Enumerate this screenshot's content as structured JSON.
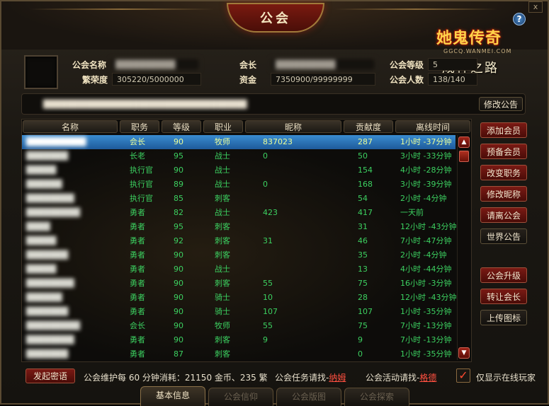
{
  "window": {
    "title": "公会",
    "help_label": "?",
    "close_label": "x"
  },
  "logo": {
    "brand": "她鬼传奇",
    "url": "GGCQ.WANMEI.COM",
    "subtitle": "成神之路"
  },
  "guild_info": {
    "name_label": "公会名称",
    "name_value": "██████████",
    "prosperity_label": "繁荣度",
    "prosperity_value": "305220/5000000",
    "leader_label": "会长",
    "leader_value": "██████████",
    "funds_label": "资金",
    "funds_value": "7350900/99999999",
    "level_label": "公会等级",
    "level_value": "5",
    "members_label": "公会人数",
    "members_value": "138/140"
  },
  "notice": {
    "text": "██████████████████████████████████",
    "edit_button": "修改公告"
  },
  "table": {
    "headers": [
      "名称",
      "职务",
      "等级",
      "职业",
      "昵称",
      "贡献度",
      "离线时间"
    ],
    "rows": [
      {
        "name": "██████████",
        "role": "会长",
        "level": "90",
        "class": "牧师",
        "nick": "837023",
        "contrib": "287",
        "offline": "1小时 -37分钟"
      },
      {
        "name": "███████",
        "role": "长老",
        "level": "95",
        "class": "战士",
        "nick": "0",
        "contrib": "50",
        "offline": "3小时 -33分钟"
      },
      {
        "name": "█████",
        "role": "执行官",
        "level": "90",
        "class": "战士",
        "nick": "",
        "contrib": "154",
        "offline": "4小时 -28分钟"
      },
      {
        "name": "██████",
        "role": "执行官",
        "level": "89",
        "class": "战士",
        "nick": "0",
        "contrib": "168",
        "offline": "3小时 -39分钟"
      },
      {
        "name": "████████",
        "role": "执行官",
        "level": "85",
        "class": "刺客",
        "nick": "",
        "contrib": "54",
        "offline": "2小时 -4分钟"
      },
      {
        "name": "█████████",
        "role": "勇者",
        "level": "82",
        "class": "战士",
        "nick": "423",
        "contrib": "417",
        "offline": "一天前"
      },
      {
        "name": "████",
        "role": "勇者",
        "level": "95",
        "class": "刺客",
        "nick": "",
        "contrib": "31",
        "offline": "12小时 -43分钟"
      },
      {
        "name": "█████",
        "role": "勇者",
        "level": "92",
        "class": "刺客",
        "nick": "31",
        "contrib": "46",
        "offline": "7小时 -47分钟"
      },
      {
        "name": "███████",
        "role": "勇者",
        "level": "90",
        "class": "刺客",
        "nick": "",
        "contrib": "35",
        "offline": "2小时 -4分钟"
      },
      {
        "name": "█████",
        "role": "勇者",
        "level": "90",
        "class": "战士",
        "nick": "",
        "contrib": "13",
        "offline": "4小时 -44分钟"
      },
      {
        "name": "████████",
        "role": "勇者",
        "level": "90",
        "class": "刺客",
        "nick": "55",
        "contrib": "75",
        "offline": "16小时 -3分钟"
      },
      {
        "name": "██████",
        "role": "勇者",
        "level": "90",
        "class": "骑士",
        "nick": "10",
        "contrib": "28",
        "offline": "12小时 -43分钟"
      },
      {
        "name": "███████",
        "role": "勇者",
        "level": "90",
        "class": "骑士",
        "nick": "107",
        "contrib": "107",
        "offline": "1小时 -35分钟"
      },
      {
        "name": "█████████",
        "role": "会长",
        "level": "90",
        "class": "牧师",
        "nick": "55",
        "contrib": "75",
        "offline": "7小时 -13分钟"
      },
      {
        "name": "████████",
        "role": "勇者",
        "level": "90",
        "class": "刺客",
        "nick": "9",
        "contrib": "9",
        "offline": "7小时 -13分钟"
      },
      {
        "name": "███████",
        "role": "勇者",
        "level": "87",
        "class": "刺客",
        "nick": "",
        "contrib": "0",
        "offline": "1小时 -35分钟"
      }
    ]
  },
  "side_buttons": [
    "添加会员",
    "预备会员",
    "改变职务",
    "修改昵称",
    "请离公会",
    "世界公告",
    "公会升级",
    "转让会长",
    "上传图标"
  ],
  "bottom": {
    "whisper_button": "发起密语",
    "maintenance_text": "公会维护每 60 分钟消耗：21150 金币、235 繁",
    "task_text": "公会任务请找-",
    "task_npc": "纳姆",
    "activity_text": "公会活动请找-",
    "activity_npc": "格德",
    "online_only_label": "仅显示在线玩家",
    "online_only_mark": "✓"
  },
  "tabs": [
    "基本信息",
    "公会信仰",
    "公会版图",
    "公会探索"
  ],
  "colors": {
    "member_text": "#3cd060",
    "selected_row": "#2a74b8",
    "npc_link": "#ff5040"
  }
}
